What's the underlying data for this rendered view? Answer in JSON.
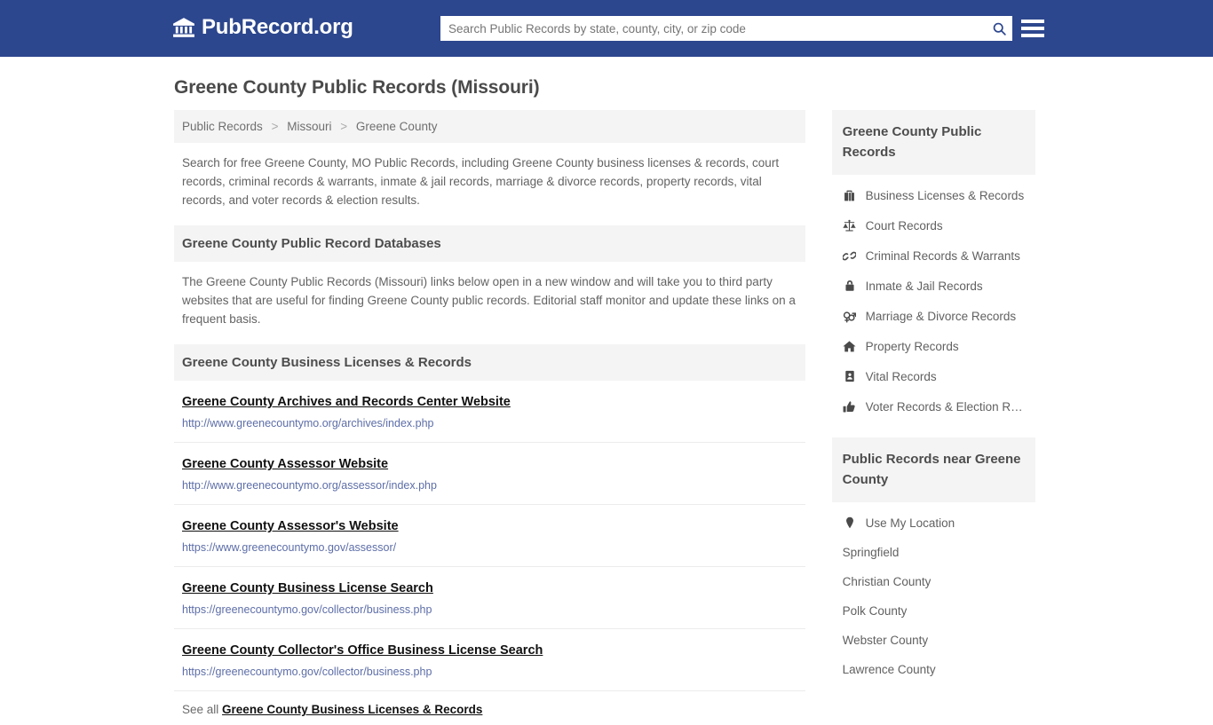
{
  "header": {
    "brand_icon": "bank-icon",
    "brand_text": "PubRecord.org",
    "search": {
      "placeholder": "Search Public Records by state, county, city, or zip code",
      "value": "",
      "button_icon": "search-icon"
    },
    "menu_icon": "hamburger-menu-icon",
    "background_color": "#2d478e"
  },
  "page": {
    "title": "Greene County Public Records (Missouri)"
  },
  "breadcrumb": {
    "items": [
      {
        "label": "Public Records"
      },
      {
        "label": "Missouri"
      },
      {
        "label": "Greene County"
      }
    ],
    "separator": ">"
  },
  "intro": {
    "text": "Search for free Greene County, MO Public Records, including Greene County business licenses & records, court records, criminal records & warrants, inmate & jail records, marriage & divorce records, property records, vital records, and voter records & election results."
  },
  "databases_section": {
    "heading": "Greene County Public Record Databases",
    "text": "The Greene County Public Records (Missouri) links below open in a new window and will take you to third party websites that are useful for finding Greene County public records. Editorial staff monitor and update these links on a frequent basis."
  },
  "business_section": {
    "heading": "Greene County Business Licenses & Records",
    "entries": [
      {
        "title": "Greene County Archives and Records Center Website",
        "url": "http://www.greenecountymo.org/archives/index.php"
      },
      {
        "title": "Greene County Assessor Website",
        "url": "http://www.greenecountymo.org/assessor/index.php"
      },
      {
        "title": "Greene County Assessor's Website",
        "url": "https://www.greenecountymo.gov/assessor/"
      },
      {
        "title": "Greene County Business License Search",
        "url": "https://greenecountymo.gov/collector/business.php"
      },
      {
        "title": "Greene County Collector's Office Business License Search",
        "url": "https://greenecountymo.gov/collector/business.php"
      }
    ],
    "see_all_prefix": "See all",
    "see_all_link": "Greene County Business Licenses & Records"
  },
  "sidebar": {
    "records_block": {
      "heading": "Greene County Public Records",
      "items": [
        {
          "label": "Business Licenses & Records",
          "icon": "briefcase-icon"
        },
        {
          "label": "Court Records",
          "icon": "scales-balance-icon"
        },
        {
          "label": "Criminal Records & Warrants",
          "icon": "handcuffs-icon"
        },
        {
          "label": "Inmate & Jail Records",
          "icon": "lock-icon"
        },
        {
          "label": "Marriage & Divorce Records",
          "icon": "venus-mars-icon"
        },
        {
          "label": "Property Records",
          "icon": "home-icon"
        },
        {
          "label": "Vital Records",
          "icon": "id-badge-icon"
        },
        {
          "label": "Voter Records & Election R…",
          "icon": "thumbs-up-icon"
        }
      ]
    },
    "near_block": {
      "heading": "Public Records near Greene County",
      "location_item": {
        "label": "Use My Location",
        "icon": "map-pin-icon"
      },
      "items": [
        {
          "label": "Springfield"
        },
        {
          "label": "Christian County"
        },
        {
          "label": "Polk County"
        },
        {
          "label": "Webster County"
        },
        {
          "label": "Lawrence County"
        }
      ]
    }
  }
}
